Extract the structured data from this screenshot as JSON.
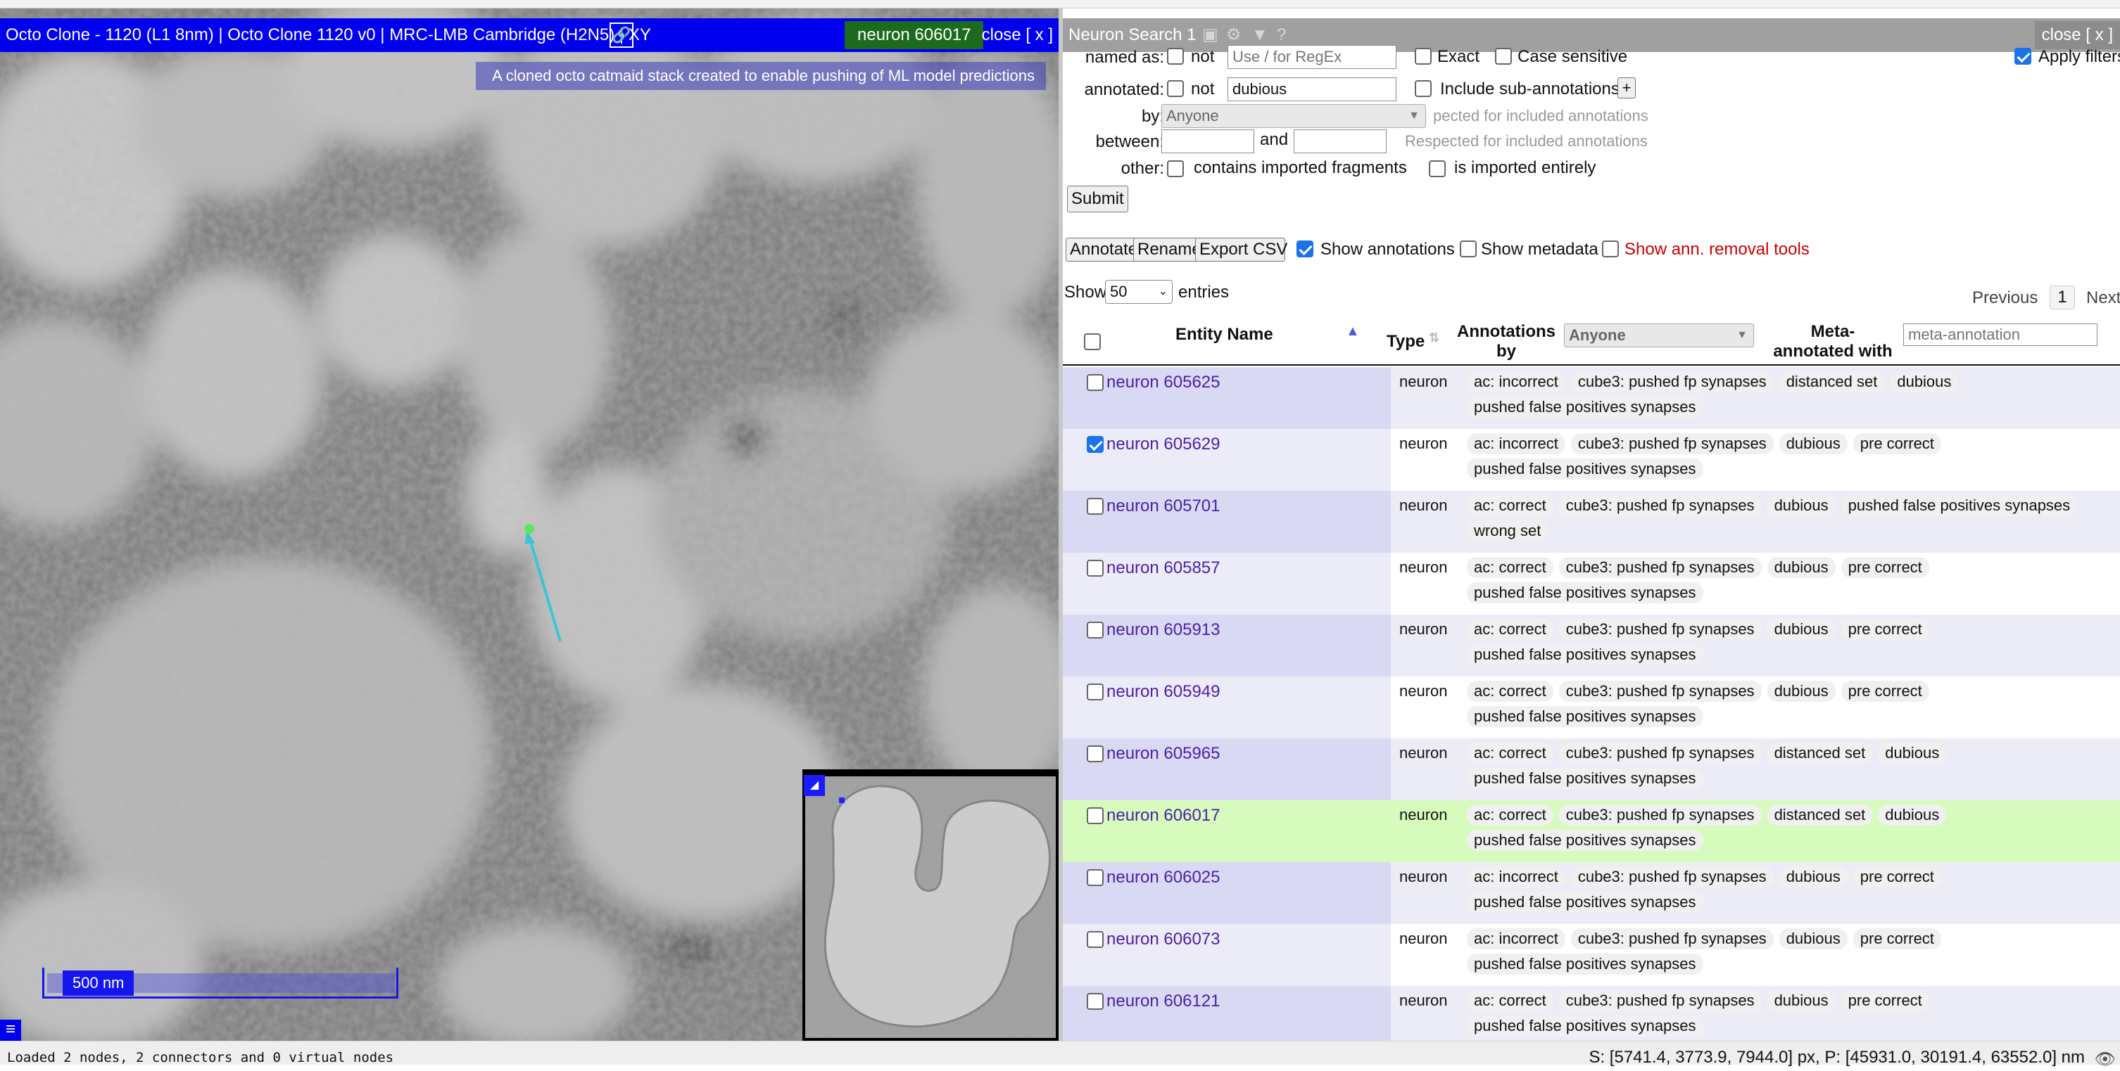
{
  "viewer": {
    "title": "Octo Clone - 1120 (L1 8nm) | Octo Clone 1120 v0 | MRC-LMB Cambridge (H2N5) | XY",
    "active_neuron": "neuron 606017",
    "close_label": "close [ x ]",
    "stack_description": "A cloned octo catmaid stack created to enable pushing of ML model predictions",
    "scale_bar_label": "500 nm",
    "link_icon": "link-icon",
    "menu_icon": "hamburger-icon"
  },
  "status": {
    "left": "Loaded 2 nodes, 2 connectors and 0 virtual nodes",
    "right": "S: [5741.4, 3773.9, 7944.0] px, P: [45931.0, 30191.4, 63552.0] nm"
  },
  "search": {
    "title": "Neuron Search 1",
    "close_label": "close [ x ]",
    "named_as_label": "named as:",
    "not_label": "not",
    "name_placeholder": "Use / for RegEx",
    "exact_label": "Exact",
    "case_label": "Case sensitive",
    "apply_filters_label": "Apply filters",
    "annotated_label": "annotated:",
    "annotation_value": "dubious",
    "include_sub_label": "Include sub-annotations",
    "plus_label": "+",
    "by_label": "by:",
    "by_value": "Anyone",
    "by_hint": "pected for included annotations",
    "between_label": "between:",
    "and_label": "and",
    "between_hint": "Respected for included annotations",
    "other_label": "other:",
    "imported_fragments_label": "contains imported fragments",
    "imported_entirely_label": "is imported entirely",
    "submit_label": "Submit",
    "annotate_label": "Annotate",
    "rename_label": "Rename",
    "export_label": "Export CSV",
    "show_annotations_label": "Show annotations",
    "show_metadata_label": "Show metadata",
    "show_removal_label": "Show ann. removal tools",
    "show_label": "Show",
    "entries_value": "50",
    "entries_label": "entries",
    "previous_label": "Previous",
    "page_number": "1",
    "next_label": "Next",
    "columns": {
      "entity_name": "Entity Name",
      "type": "Type",
      "annotations_by": "Annotations by",
      "annotations_by_value": "Anyone",
      "meta_annotated": "Meta-annotated with",
      "meta_placeholder": "meta-annotation"
    },
    "rows": [
      {
        "name": "neuron 605625",
        "type": "neuron",
        "checked": false,
        "tags": [
          "ac: incorrect",
          "cube3: pushed fp synapses",
          "distanced set",
          "dubious",
          "pushed false positives synapses"
        ]
      },
      {
        "name": "neuron 605629",
        "type": "neuron",
        "checked": true,
        "tags": [
          "ac: incorrect",
          "cube3: pushed fp synapses",
          "dubious",
          "pre correct",
          "pushed false positives synapses"
        ]
      },
      {
        "name": "neuron 605701",
        "type": "neuron",
        "checked": false,
        "tags": [
          "ac: correct",
          "cube3: pushed fp synapses",
          "dubious",
          "pushed false positives synapses",
          "wrong set"
        ]
      },
      {
        "name": "neuron 605857",
        "type": "neuron",
        "checked": false,
        "tags": [
          "ac: correct",
          "cube3: pushed fp synapses",
          "dubious",
          "pre correct",
          "pushed false positives synapses"
        ]
      },
      {
        "name": "neuron 605913",
        "type": "neuron",
        "checked": false,
        "tags": [
          "ac: correct",
          "cube3: pushed fp synapses",
          "dubious",
          "pre correct",
          "pushed false positives synapses"
        ]
      },
      {
        "name": "neuron 605949",
        "type": "neuron",
        "checked": false,
        "tags": [
          "ac: correct",
          "cube3: pushed fp synapses",
          "dubious",
          "pre correct",
          "pushed false positives synapses"
        ]
      },
      {
        "name": "neuron 605965",
        "type": "neuron",
        "checked": false,
        "tags": [
          "ac: correct",
          "cube3: pushed fp synapses",
          "distanced set",
          "dubious",
          "pushed false positives synapses"
        ]
      },
      {
        "name": "neuron 606017",
        "type": "neuron",
        "checked": false,
        "highlight": true,
        "tags": [
          "ac: correct",
          "cube3: pushed fp synapses",
          "distanced set",
          "dubious",
          "pushed false positives synapses"
        ]
      },
      {
        "name": "neuron 606025",
        "type": "neuron",
        "checked": false,
        "tags": [
          "ac: incorrect",
          "cube3: pushed fp synapses",
          "dubious",
          "pre correct",
          "pushed false positives synapses"
        ]
      },
      {
        "name": "neuron 606073",
        "type": "neuron",
        "checked": false,
        "tags": [
          "ac: incorrect",
          "cube3: pushed fp synapses",
          "dubious",
          "pre correct",
          "pushed false positives synapses"
        ]
      },
      {
        "name": "neuron 606121",
        "type": "neuron",
        "checked": false,
        "tags": [
          "ac: correct",
          "cube3: pushed fp synapses",
          "dubious",
          "pre correct",
          "pushed false positives synapses"
        ]
      }
    ]
  },
  "colors": {
    "title_bar": "#0000ee",
    "neuron_badge": "#1c6b1c",
    "link": "#4b1fa8",
    "highlight_row": "#d7fbbd",
    "removal_tools": "#cc0000"
  }
}
